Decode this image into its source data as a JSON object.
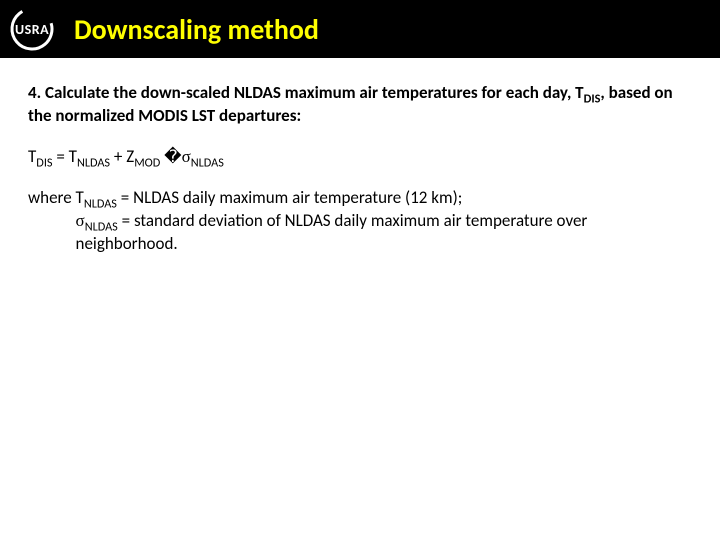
{
  "header": {
    "logo_text": "USRA",
    "title": "Downscaling method"
  },
  "body": {
    "intro_a": "4. Calculate the down-scaled NLDAS maximum air temperatures for each day, T",
    "intro_sub": "DIS",
    "intro_b": ", based on the normalized MODIS LST departures:",
    "eq": {
      "t": "T",
      "dis": "DIS",
      "equals": " = T",
      "nldas": "NLDAS",
      "plus": "  + Z",
      "mod": "MOD",
      "glyph": " �",
      "sigma": "σ",
      "nldas2": "NLDAS"
    },
    "where": "where  ",
    "def1_a": "T",
    "def1_sub": "NLDAS",
    "def1_b": " = NLDAS daily maximum air temperature (12 km);",
    "def2_sigma": "σ",
    "def2_sub": "NLDAS",
    "def2_b": " = standard deviation of NLDAS daily maximum air temperature over neighborhood."
  }
}
